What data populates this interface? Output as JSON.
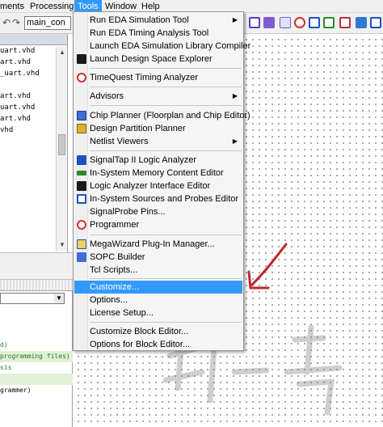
{
  "menubar": {
    "items": [
      "ments",
      "Processing",
      "Tools",
      "Window",
      "Help"
    ]
  },
  "toolbar": {
    "combo_value": "main_con"
  },
  "file_list": [
    "uart.vhd",
    "art.vhd",
    "_uart.vhd",
    "art.vhd",
    "uart.vhd",
    "art.vhd",
    "vhd"
  ],
  "messages": {
    "lines": [
      "d)",
      "programming files)",
      "sis",
      "",
      "grammer)"
    ]
  },
  "tools_menu": {
    "items": [
      {
        "label": "Run EDA Simulation Tool",
        "submenu": true
      },
      {
        "label": "Run EDA Timing Analysis Tool"
      },
      {
        "label": "Launch EDA Simulation Library Compiler"
      },
      {
        "label": "Launch Design Space Explorer"
      },
      {
        "label": "TimeQuest Timing Analyzer"
      },
      {
        "label": "Advisors",
        "submenu": true
      },
      {
        "label": "Chip Planner (Floorplan and Chip Editor)"
      },
      {
        "label": "Design Partition Planner"
      },
      {
        "label": "Netlist Viewers",
        "submenu": true
      },
      {
        "label": "SignalTap II Logic Analyzer"
      },
      {
        "label": "In-System Memory Content Editor"
      },
      {
        "label": "Logic Analyzer Interface Editor"
      },
      {
        "label": "In-System Sources and Probes Editor"
      },
      {
        "label": "SignalProbe Pins..."
      },
      {
        "label": "Programmer"
      },
      {
        "label": "MegaWizard Plug-In Manager..."
      },
      {
        "label": "SOPC Builder"
      },
      {
        "label": "Tcl Scripts..."
      },
      {
        "label": "Customize...",
        "selected": true
      },
      {
        "label": "Options..."
      },
      {
        "label": "License Setup..."
      },
      {
        "label": "Customize Block Editor..."
      },
      {
        "label": "Options for Block Editor..."
      }
    ]
  },
  "watermark_text": "知 一 步",
  "colors": {
    "selection": "#3399ff",
    "annotation_arrow": "#c0282c"
  }
}
